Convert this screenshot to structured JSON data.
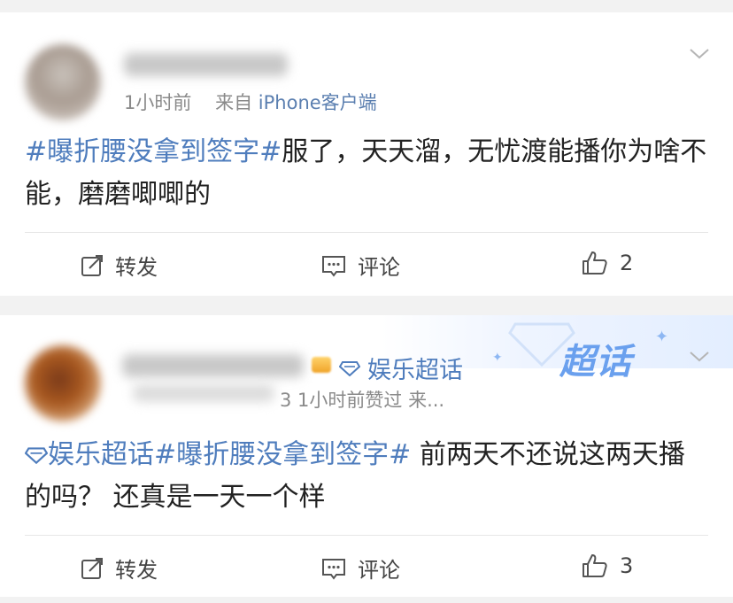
{
  "posts": [
    {
      "meta_time": "1小时前",
      "meta_from": "来自",
      "meta_source": "iPhone客户端",
      "topic": "#曝折腰没拿到签字#",
      "text": "服了，天天溜，无忧渡能播你为啥不能，磨磨唧唧的",
      "actions": {
        "repost": "转发",
        "comment": "评论",
        "like_count": "2"
      }
    },
    {
      "badge_label": "娱乐超话",
      "meta": "3 1小时前赞过 来...",
      "super_topic": "娱乐超话",
      "topic": "#曝折腰没拿到签字#",
      "text": " 前两天不还说这两天播的吗？ 还真是一天一个样",
      "actions": {
        "repost": "转发",
        "comment": "评论",
        "like_count": "3"
      },
      "header_logo": "超话"
    }
  ],
  "colors": {
    "link": "#4f7dbd",
    "meta": "#8a8a8a",
    "source": "#5b7fb0",
    "background": "#f2f2f2"
  }
}
